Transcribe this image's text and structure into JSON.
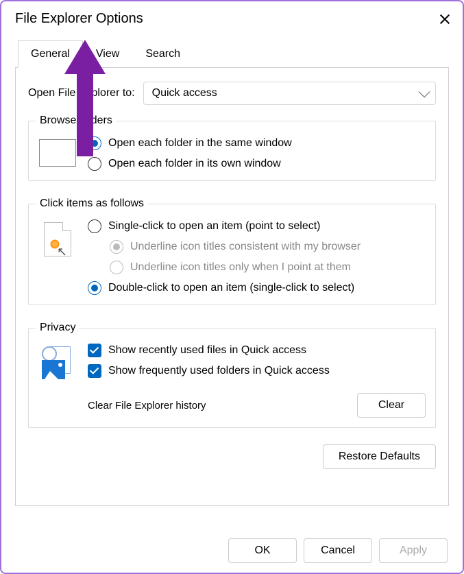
{
  "window": {
    "title": "File Explorer Options"
  },
  "tabs": {
    "general": "General",
    "view": "View",
    "search": "Search"
  },
  "openTo": {
    "label": "Open File Explorer to:",
    "value": "Quick access"
  },
  "browse": {
    "legend": "Browse folders",
    "same": "Open each folder in the same window",
    "own": "Open each folder in its own window"
  },
  "click": {
    "legend": "Click items as follows",
    "single": "Single-click to open an item (point to select)",
    "underlineBrowser": "Underline icon titles consistent with my browser",
    "underlinePoint": "Underline icon titles only when I point at them",
    "double": "Double-click to open an item (single-click to select)"
  },
  "privacy": {
    "legend": "Privacy",
    "recentFiles": "Show recently used files in Quick access",
    "freqFolders": "Show frequently used folders in Quick access",
    "clearLabel": "Clear File Explorer history",
    "clearBtn": "Clear"
  },
  "buttons": {
    "restore": "Restore Defaults",
    "ok": "OK",
    "cancel": "Cancel",
    "apply": "Apply"
  },
  "colors": {
    "accent": "#0067c0",
    "annotation": "#7b1fa2"
  }
}
